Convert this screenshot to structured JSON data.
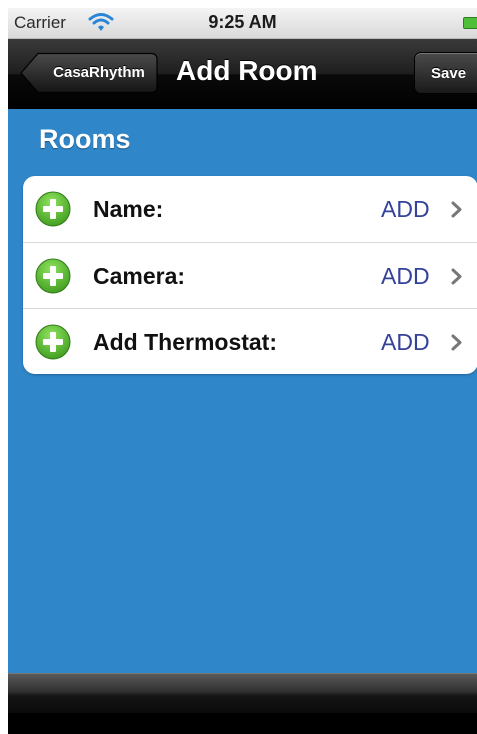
{
  "status_bar": {
    "carrier": "Carrier",
    "time": "9:25 AM"
  },
  "nav_bar": {
    "back_label": "CasaRhythm",
    "title": "Add Room",
    "save_label": "Save"
  },
  "section": {
    "header": "Rooms"
  },
  "rows": [
    {
      "label": "Name:",
      "value": "ADD"
    },
    {
      "label": "Camera:",
      "value": "ADD"
    },
    {
      "label": "Add Thermostat:",
      "value": "ADD"
    }
  ],
  "colors": {
    "background": "#2f86c8",
    "accent_value": "#34429a",
    "plus_icon": "#5bb832"
  },
  "icons": {
    "row_icon": "plus-circle-icon",
    "disclosure": "chevron-right-icon"
  }
}
